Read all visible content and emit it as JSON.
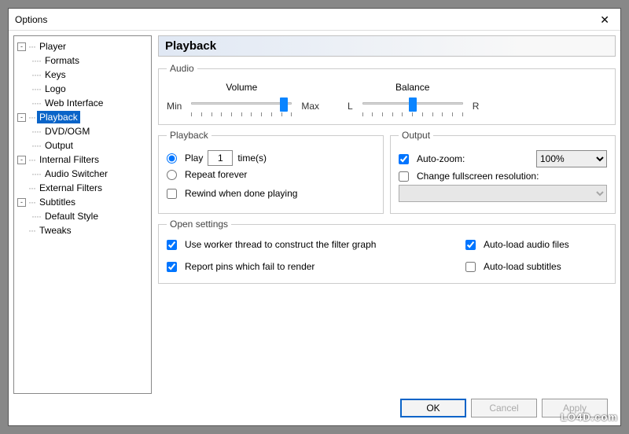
{
  "window": {
    "title": "Options"
  },
  "tree": {
    "items": [
      {
        "label": "Player",
        "level": 0,
        "toggle": "-",
        "selected": false
      },
      {
        "label": "Formats",
        "level": 1,
        "selected": false
      },
      {
        "label": "Keys",
        "level": 1,
        "selected": false
      },
      {
        "label": "Logo",
        "level": 1,
        "selected": false
      },
      {
        "label": "Web Interface",
        "level": 1,
        "selected": false
      },
      {
        "label": "Playback",
        "level": 0,
        "toggle": "-",
        "selected": true
      },
      {
        "label": "DVD/OGM",
        "level": 1,
        "selected": false
      },
      {
        "label": "Output",
        "level": 1,
        "selected": false
      },
      {
        "label": "Internal Filters",
        "level": 0,
        "toggle": "-",
        "selected": false
      },
      {
        "label": "Audio Switcher",
        "level": 1,
        "selected": false
      },
      {
        "label": "External Filters",
        "level": 0,
        "selected": false
      },
      {
        "label": "Subtitles",
        "level": 0,
        "toggle": "-",
        "selected": false
      },
      {
        "label": "Default Style",
        "level": 1,
        "selected": false
      },
      {
        "label": "Tweaks",
        "level": 0,
        "selected": false
      }
    ]
  },
  "header": "Playback",
  "audio": {
    "legend": "Audio",
    "volume": {
      "label": "Volume",
      "min": "Min",
      "max": "Max",
      "percent": 92
    },
    "balance": {
      "label": "Balance",
      "left": "L",
      "right": "R",
      "percent": 50
    }
  },
  "playback": {
    "legend": "Playback",
    "play_label": "Play",
    "play_times": "1",
    "times_suffix": "time(s)",
    "repeat_label": "Repeat forever",
    "rewind_label": "Rewind when done playing"
  },
  "output": {
    "legend": "Output",
    "autozoom_label": "Auto-zoom:",
    "autozoom_value": "100%",
    "changeres_label": "Change fullscreen resolution:"
  },
  "open": {
    "legend": "Open settings",
    "worker_label": "Use worker thread to construct the filter graph",
    "report_label": "Report pins which fail to render",
    "autoaudio_label": "Auto-load audio files",
    "autosubs_label": "Auto-load subtitles"
  },
  "buttons": {
    "ok": "OK",
    "cancel": "Cancel",
    "apply": "Apply"
  },
  "watermark": "LO4D.com"
}
